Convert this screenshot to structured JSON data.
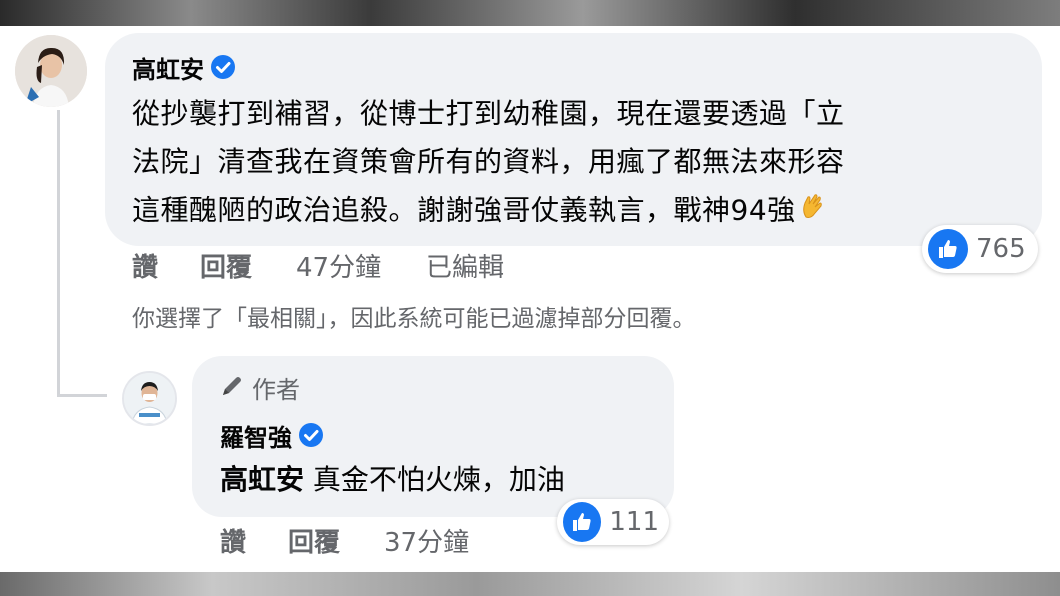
{
  "main_comment": {
    "author": "高虹安",
    "lines": [
      "從抄襲打到補習，從博士打到幼稚園，現在還要透過「立",
      "法院」清查我在資策會所有的資料，用瘋了都無法來形容",
      "這種醜陋的政治追殺。謝謝強哥仗義執言，戰神94強"
    ],
    "emoji": "clap-hands-emoji",
    "reactions": "765",
    "actions": {
      "like": "讚",
      "reply": "回覆",
      "time": "47分鐘",
      "edited": "已編輯"
    }
  },
  "filter_note": "你選擇了「最相關」，因此系統可能已過濾掉部分回覆。",
  "reply_comment": {
    "badge": "作者",
    "author": "羅智強",
    "mention": "高虹安",
    "text": "真金不怕火煉，加油",
    "reactions": "111",
    "actions": {
      "like": "讚",
      "reply": "回覆",
      "time": "37分鐘"
    }
  },
  "colors": {
    "bubble": "#f0f2f5",
    "meta_gray": "#65676b",
    "like_blue": "#1877f2",
    "text": "#050505"
  }
}
